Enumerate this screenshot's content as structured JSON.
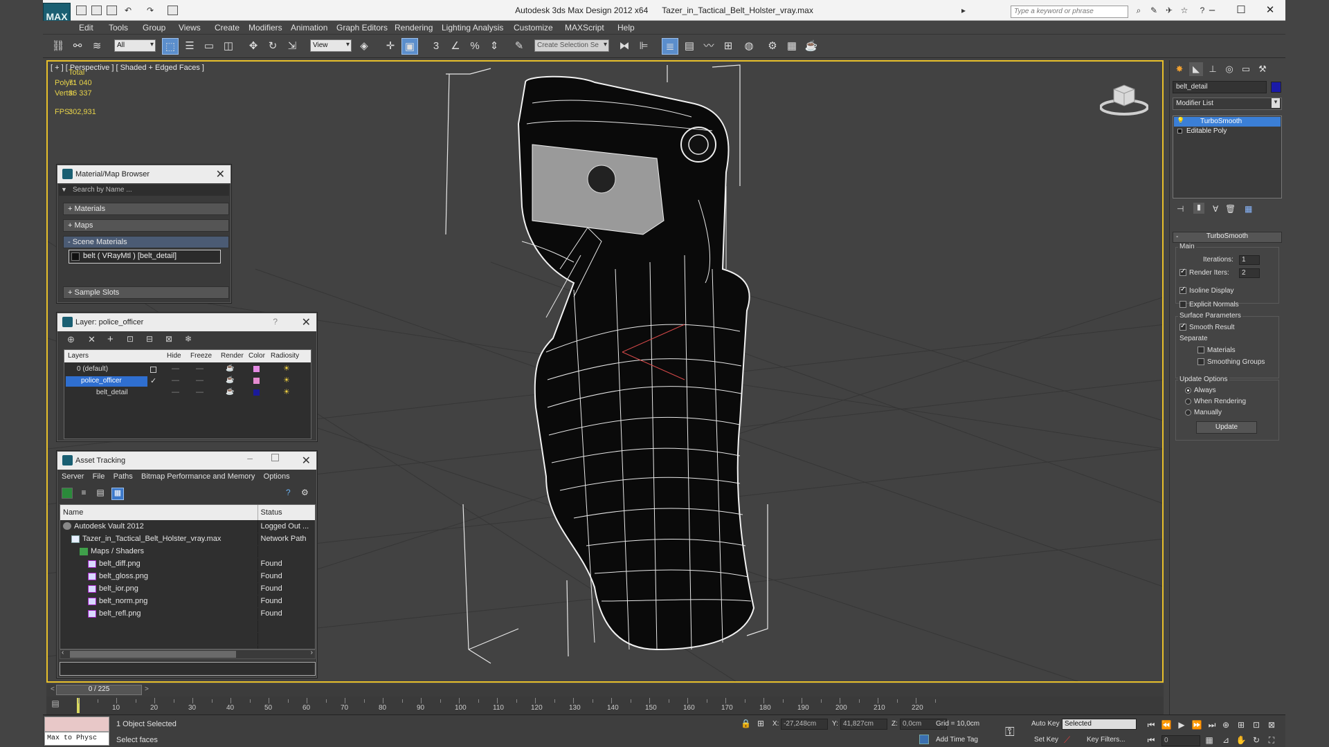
{
  "titlebar": {
    "app": "Autodesk 3ds Max Design 2012 x64",
    "file": "Tazer_in_Tactical_Belt_Holster_vray.max",
    "search_placeholder": "Type a keyword or phrase",
    "logo": "MAX"
  },
  "menu": [
    "Edit",
    "Tools",
    "Group",
    "Views",
    "Create",
    "Modifiers",
    "Animation",
    "Graph Editors",
    "Rendering",
    "Lighting Analysis",
    "Customize",
    "MAXScript",
    "Help"
  ],
  "toolbar": {
    "selection_filter": "All",
    "ref_coord": "View",
    "named_selection": "Create Selection Se"
  },
  "viewport": {
    "label": "[ + ] [ Perspective ] [ Shaded + Edged Faces ]",
    "stats": {
      "total_label": "Total",
      "polys_label": "Polys:",
      "polys": "71 040",
      "verts_label": "Verts:",
      "verts": "36 337",
      "fps_label": "FPS:",
      "fps": "302,931"
    }
  },
  "material_browser": {
    "title": "Material/Map Browser",
    "search_placeholder": "Search by Name ...",
    "rollouts": [
      "+ Materials",
      "+ Maps",
      "- Scene Materials",
      "+ Sample Slots"
    ],
    "scene_material": "belt  ( VRayMtl )  [belt_detail]"
  },
  "layer_window": {
    "title": "Layer: police_officer",
    "help": "?",
    "columns": [
      "Layers",
      "Hide",
      "Freeze",
      "Render",
      "Color",
      "Radiosity"
    ],
    "rows": [
      {
        "name": "0 (default)",
        "color": "#e58be4"
      },
      {
        "name": "police_officer",
        "color": "#e58bd0"
      },
      {
        "name": "belt_detail",
        "color": "#1a1a9a"
      }
    ]
  },
  "asset_tracking": {
    "title": "Asset Tracking",
    "menu": [
      "Server",
      "File",
      "Paths",
      "Bitmap Performance and Memory",
      "Options"
    ],
    "columns": [
      "Name",
      "Status"
    ],
    "rows": [
      {
        "name": "Autodesk Vault 2012",
        "status": "Logged Out ...",
        "indent": 1
      },
      {
        "name": "Tazer_in_Tactical_Belt_Holster_vray.max",
        "status": "Network Path",
        "indent": 2
      },
      {
        "name": "Maps / Shaders",
        "status": "",
        "indent": 3
      },
      {
        "name": "belt_diff.png",
        "status": "Found",
        "indent": 4
      },
      {
        "name": "belt_gloss.png",
        "status": "Found",
        "indent": 4
      },
      {
        "name": "belt_ior.png",
        "status": "Found",
        "indent": 4
      },
      {
        "name": "belt_norm.png",
        "status": "Found",
        "indent": 4
      },
      {
        "name": "belt_refl.png",
        "status": "Found",
        "indent": 4
      }
    ]
  },
  "command_panel": {
    "object_name": "belt_detail",
    "object_color": "#1a1aa8",
    "modifier_list": "Modifier List",
    "stack": [
      "TurboSmooth",
      "Editable Poly"
    ],
    "rollout_title": "TurboSmooth",
    "main_label": "Main",
    "iterations_label": "Iterations:",
    "iterations": "1",
    "render_iters_label": "Render Iters:",
    "render_iters": "2",
    "isoline": "Isoline Display",
    "explicit_normals": "Explicit Normals",
    "surface_params": "Surface Parameters",
    "smooth_result": "Smooth Result",
    "separate": "Separate",
    "materials": "Materials",
    "smoothing_groups": "Smoothing Groups",
    "update_options": "Update Options",
    "always": "Always",
    "when_rendering": "When Rendering",
    "manually": "Manually",
    "update_button": "Update"
  },
  "timeline": {
    "frame": "0 / 225",
    "ticks": [
      "10",
      "20",
      "30",
      "40",
      "50",
      "60",
      "70",
      "80",
      "90",
      "100",
      "110",
      "120",
      "130",
      "140",
      "150",
      "160",
      "170",
      "180",
      "190",
      "200",
      "210",
      "220"
    ]
  },
  "status": {
    "script_listener": "Max to Physc",
    "selected": "1 Object Selected",
    "prompt": "Select faces",
    "x_label": "X:",
    "x": "-27,248cm",
    "y_label": "Y:",
    "y": "41,827cm",
    "z_label": "Z:",
    "z": "0,0cm",
    "grid": "Grid = 10,0cm",
    "add_time_tag": "Add Time Tag",
    "auto_key": "Auto Key",
    "set_key": "Set Key",
    "key_mode": "Selected",
    "key_filters": "Key Filters...",
    "frame_field": "0"
  }
}
